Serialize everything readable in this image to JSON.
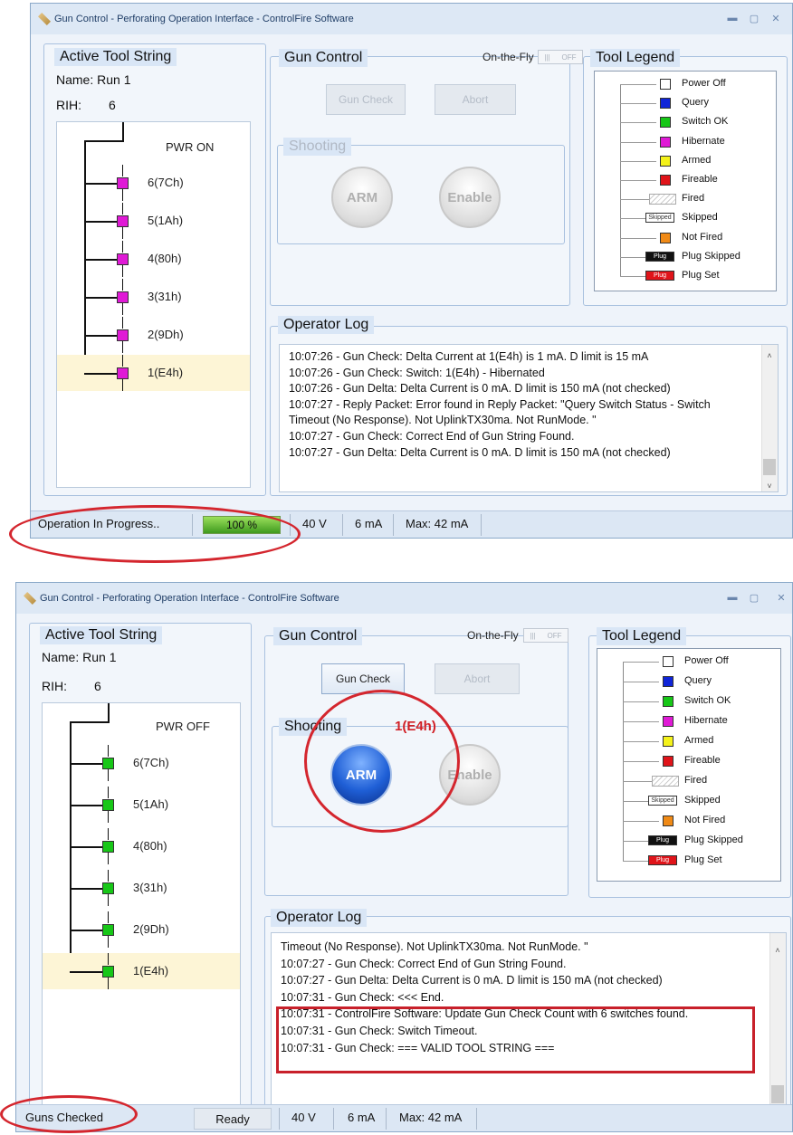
{
  "window": {
    "title": "Gun Control - Perforating Operation Interface - ControlFire Software"
  },
  "common": {
    "active_tool_string": "Active Tool String",
    "name_line": "Name:  Run 1",
    "rih_label": "RIH:",
    "rih_value": "6",
    "gun_control": "Gun Control",
    "on_the_fly": "On-the-Fly",
    "toggle_off": "OFF",
    "gun_check": "Gun Check",
    "abort": "Abort",
    "shooting": "Shooting",
    "arm": "ARM",
    "enable": "Enable",
    "tool_legend": "Tool Legend",
    "operator_log": "Operator Log",
    "voltage": "40 V",
    "current": "6 mA",
    "max_current": "Max: 42 mA"
  },
  "colors": {
    "pending": "#e01ad6",
    "ok": "#17c717",
    "annotation": "#d4262e"
  },
  "tool_nodes": [
    "6(7Ch)",
    "5(1Ah)",
    "4(80h)",
    "3(31h)",
    "2(9Dh)",
    "1(E4h)"
  ],
  "legend": [
    {
      "label": "Power Off",
      "icon": "white-square-icon",
      "color": "#ffffff"
    },
    {
      "label": "Query",
      "icon": "blue-square-icon",
      "color": "#1025d8"
    },
    {
      "label": "Switch OK",
      "icon": "green-square-icon",
      "color": "#17c717"
    },
    {
      "label": "Hibernate",
      "icon": "magenta-square-icon",
      "color": "#e01ad6"
    },
    {
      "label": "Armed",
      "icon": "yellow-square-icon",
      "color": "#f4f21a"
    },
    {
      "label": "Fireable",
      "icon": "red-square-icon",
      "color": "#e0141a"
    },
    {
      "label": "Fired",
      "icon": "hatched-icon",
      "color": "#ffffff"
    },
    {
      "label": "Skipped",
      "icon": "skipped-box-icon",
      "color": "#ffffff",
      "tag": "Skipped"
    },
    {
      "label": "Not Fired",
      "icon": "orange-square-icon",
      "color": "#f08a16"
    },
    {
      "label": "Plug Skipped",
      "icon": "plug-black-icon",
      "color": "#111111",
      "tag": "Plug"
    },
    {
      "label": "Plug Set",
      "icon": "plug-red-icon",
      "color": "#e0141a",
      "tag": "Plug"
    }
  ],
  "screen1": {
    "power": "PWR ON",
    "log": [
      "10:07:26 - Gun Check: Delta Current at 1(E4h) is 1 mA. D limit is 15 mA",
      "10:07:26 - Gun Check: Switch: 1(E4h) - Hibernated",
      "10:07:26 - Gun Delta: Delta Current is 0 mA. D limit is 150 mA (not checked)",
      "10:07:27 - Reply Packet: Error found in Reply Packet: \"Query Switch Status - Switch",
      "Timeout (No Response). Not UplinkTX30ma. Not RunMode. \"",
      "10:07:27 - Gun Check: Correct End of Gun String Found.",
      "10:07:27 - Gun Delta: Delta Current is 0 mA. D limit is 150 mA (not checked)"
    ],
    "status_text": "Operation In Progress..",
    "progress_label": "100 %",
    "progress": 1.0
  },
  "screen2": {
    "power": "PWR OFF",
    "selected_switch": "1(E4h)",
    "log": [
      "Timeout (No Response). Not UplinkTX30ma. Not RunMode. \"",
      "10:07:27 - Gun Check: Correct End of Gun String Found.",
      "10:07:27 - Gun Delta: Delta Current is 0 mA. D limit is 150 mA (not checked)",
      "10:07:31 - Gun Check: <<< End.",
      "10:07:31 - ControlFire Software: Update Gun Check Count with 6 switches found.",
      "10:07:31 - Gun Check:  Switch Timeout.",
      "10:07:31 - Gun Check: === VALID TOOL STRING ==="
    ],
    "status_text": "Guns Checked",
    "ready": "Ready"
  }
}
